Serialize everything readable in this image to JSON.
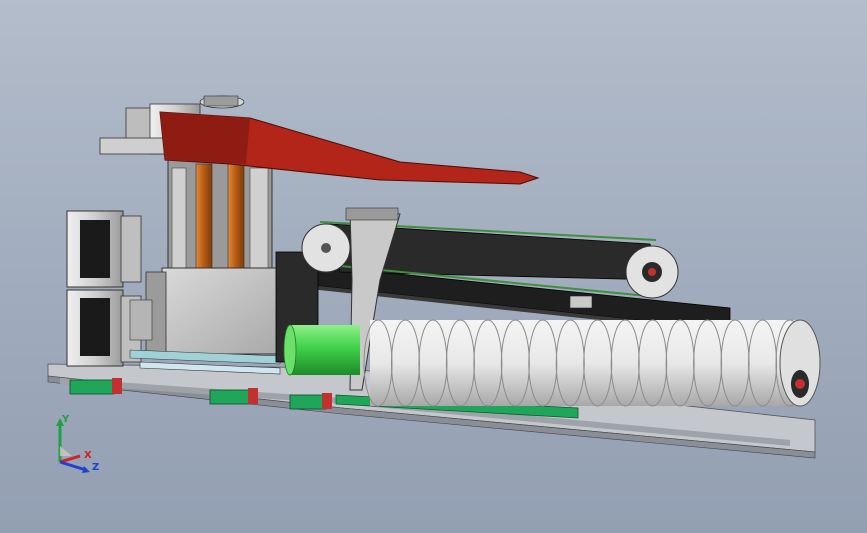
{
  "triad": {
    "y_label": "Y",
    "x_label": "X",
    "z_label": "Z",
    "colors": {
      "y": "#20a040",
      "x": "#d02020",
      "z": "#2040d0"
    }
  },
  "colors": {
    "background_top": "#b3bdcb",
    "background_bottom": "#939fb2",
    "arm_red": "#b32518",
    "rail_green": "#1fa65a",
    "cylinder_green": "#3fd24a",
    "plate_gray": "#c7c7c7",
    "frame_dark": "#1e1e1e",
    "motor_gray": "#d8d8d8",
    "roller_white": "#ececec",
    "column_orange": "#c76a1c",
    "base_gray": "#b9bcc2"
  },
  "roller": {
    "ring_count": 16
  }
}
